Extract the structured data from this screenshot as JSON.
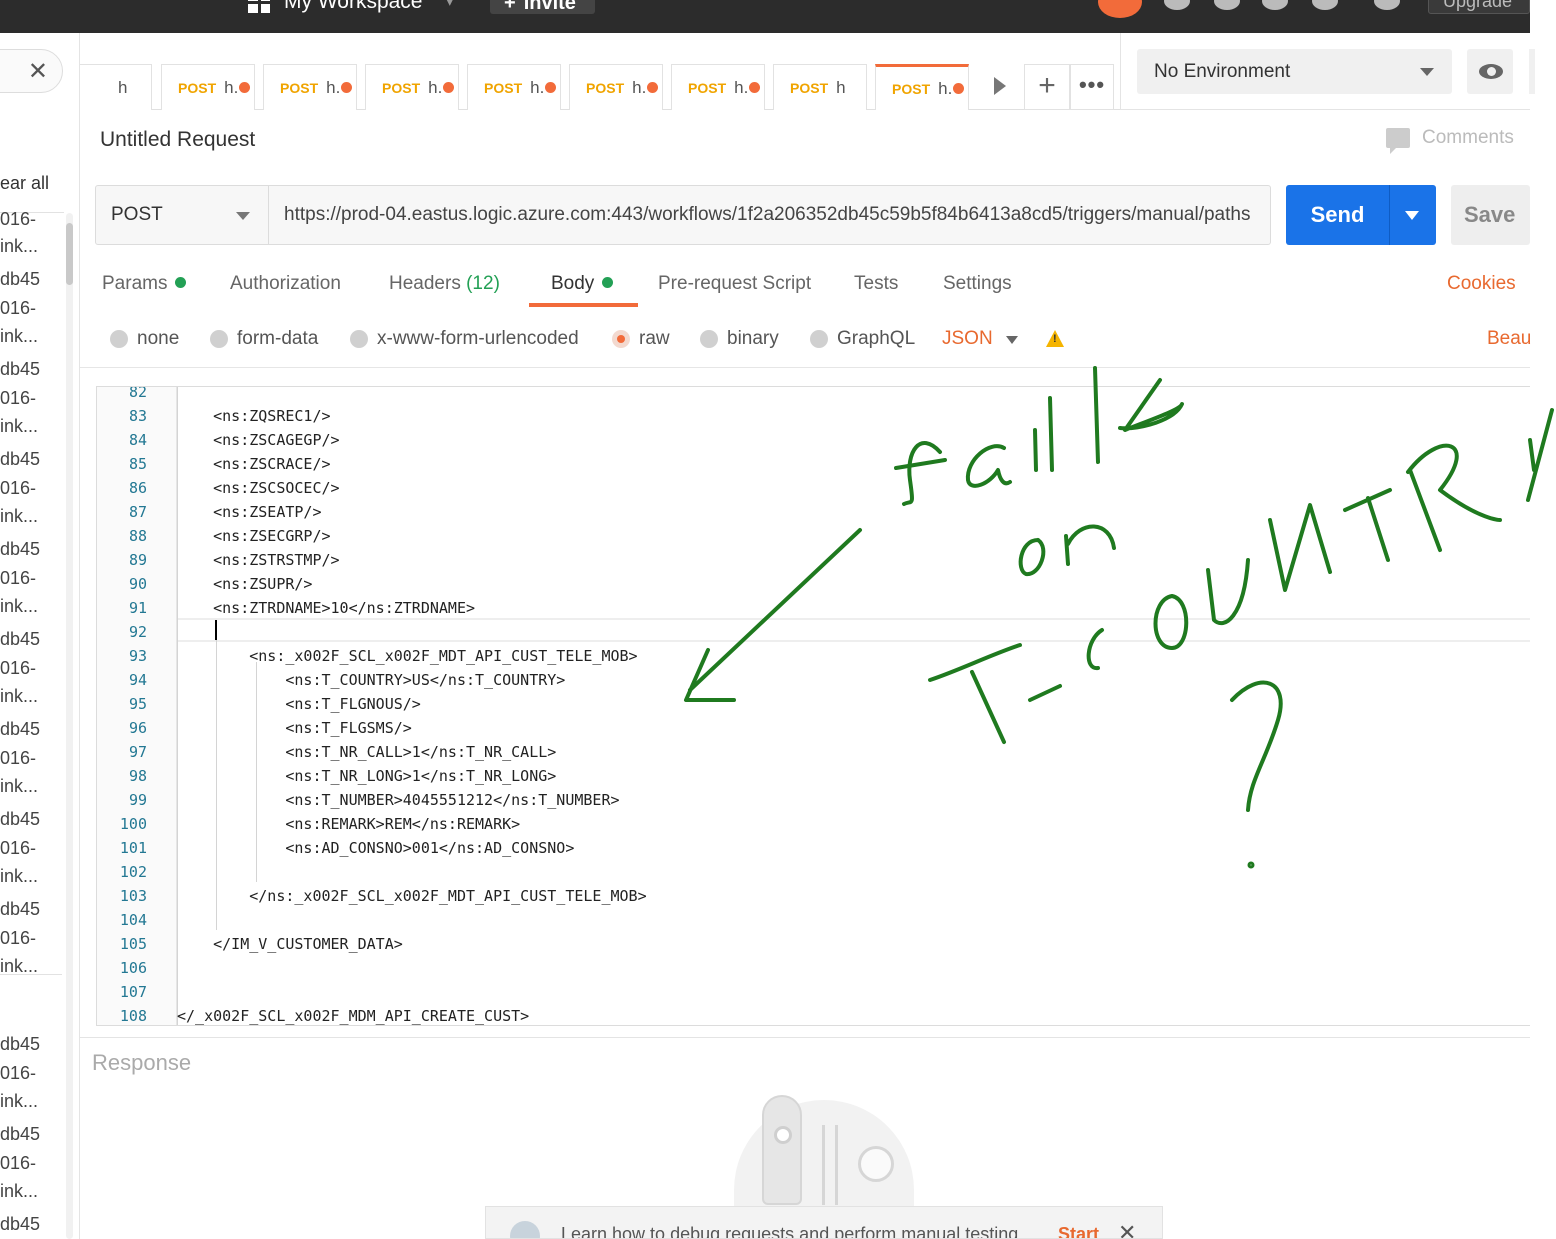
{
  "topbar": {
    "workspace": "My Workspace",
    "invite": "Invite",
    "upgrade": "Upgrade"
  },
  "sidebar": {
    "clear_all": "ear all",
    "items": [
      "016-",
      "ink...",
      "db45",
      "016-",
      "ink...",
      "db45",
      "016-",
      "ink...",
      "db45",
      "016-",
      "ink...",
      "db45",
      "016-",
      "ink...",
      "db45",
      "016-",
      "ink...",
      "db45",
      "016-",
      "ink...",
      "db45",
      "016-",
      "ink...",
      "db45",
      "016-",
      "ink...",
      "db45",
      "016-",
      "ink...",
      "db45",
      "016-",
      "ink...",
      "db45"
    ]
  },
  "tabs": {
    "first_name": "h",
    "items": [
      {
        "method": "POST",
        "name": "h."
      },
      {
        "method": "POST",
        "name": "h."
      },
      {
        "method": "POST",
        "name": "h."
      },
      {
        "method": "POST",
        "name": "h."
      },
      {
        "method": "POST",
        "name": "h."
      },
      {
        "method": "POST",
        "name": "h."
      },
      {
        "method": "POST",
        "name": "h"
      },
      {
        "method": "POST",
        "name": "h."
      }
    ],
    "add": "+",
    "more": "•••"
  },
  "environment": {
    "selected": "No Environment"
  },
  "request": {
    "title": "Untitled Request",
    "comments": "Comments",
    "method": "POST",
    "url": "https://prod-04.eastus.logic.azure.com:443/workflows/1f2a206352db45c59b5f84b6413a8cd5/triggers/manual/paths",
    "send": "Send",
    "save": "Save"
  },
  "request_tabs": {
    "params": "Params",
    "authorization": "Authorization",
    "headers": "Headers",
    "headers_count": "(12)",
    "body": "Body",
    "prerequest": "Pre-request Script",
    "tests": "Tests",
    "settings": "Settings",
    "cookies": "Cookies"
  },
  "body_options": {
    "none": "none",
    "form_data": "form-data",
    "urlencoded": "x-www-form-urlencoded",
    "raw": "raw",
    "binary": "binary",
    "graphql": "GraphQL",
    "language": "JSON",
    "beautify": "Beau"
  },
  "editor": {
    "lines": [
      {
        "n": "82",
        "text": ""
      },
      {
        "n": "83",
        "text": "    <ns:ZQSREC1/>"
      },
      {
        "n": "84",
        "text": "    <ns:ZSCAGEGP/>"
      },
      {
        "n": "85",
        "text": "    <ns:ZSCRACE/>"
      },
      {
        "n": "86",
        "text": "    <ns:ZSCSOCEC/>"
      },
      {
        "n": "87",
        "text": "    <ns:ZSEATP/>"
      },
      {
        "n": "88",
        "text": "    <ns:ZSECGRP/>"
      },
      {
        "n": "89",
        "text": "    <ns:ZSTRSTMP/>"
      },
      {
        "n": "90",
        "text": "    <ns:ZSUPR/>"
      },
      {
        "n": "91",
        "text": "    <ns:ZTRDNAME>10</ns:ZTRDNAME>"
      },
      {
        "n": "92",
        "text": ""
      },
      {
        "n": "93",
        "text": "        <ns:_x002F_SCL_x002F_MDT_API_CUST_TELE_MOB>"
      },
      {
        "n": "94",
        "text": "            <ns:T_COUNTRY>US</ns:T_COUNTRY>"
      },
      {
        "n": "95",
        "text": "            <ns:T_FLGNOUS/>"
      },
      {
        "n": "96",
        "text": "            <ns:T_FLGSMS/>"
      },
      {
        "n": "97",
        "text": "            <ns:T_NR_CALL>1</ns:T_NR_CALL>"
      },
      {
        "n": "98",
        "text": "            <ns:T_NR_LONG>1</ns:T_NR_LONG>"
      },
      {
        "n": "99",
        "text": "            <ns:T_NUMBER>4045551212</ns:T_NUMBER>"
      },
      {
        "n": "100",
        "text": "            <ns:REMARK>REM</ns:REMARK>"
      },
      {
        "n": "101",
        "text": "            <ns:AD_CONSNO>001</ns:AD_CONSNO>"
      },
      {
        "n": "102",
        "text": ""
      },
      {
        "n": "103",
        "text": "        </ns:_x002F_SCL_x002F_MDT_API_CUST_TELE_MOB>"
      },
      {
        "n": "104",
        "text": ""
      },
      {
        "n": "105",
        "text": "    </IM_V_CUSTOMER_DATA>"
      },
      {
        "n": "106",
        "text": ""
      },
      {
        "n": "107",
        "text": ""
      },
      {
        "n": "108",
        "text": "</_x002F_SCL_x002F_MDM_API_CREATE_CUST>"
      }
    ]
  },
  "annotation": {
    "color": "#1f7a1f"
  },
  "response": {
    "label": "Response"
  },
  "toast": {
    "text": "Learn how to debug requests and perform manual testing",
    "start": "Start",
    "close": "✕"
  },
  "colors": {
    "accent": "#f26b3a",
    "send": "#1a73e8",
    "method": "#f0a400",
    "status_green": "#23a055"
  }
}
